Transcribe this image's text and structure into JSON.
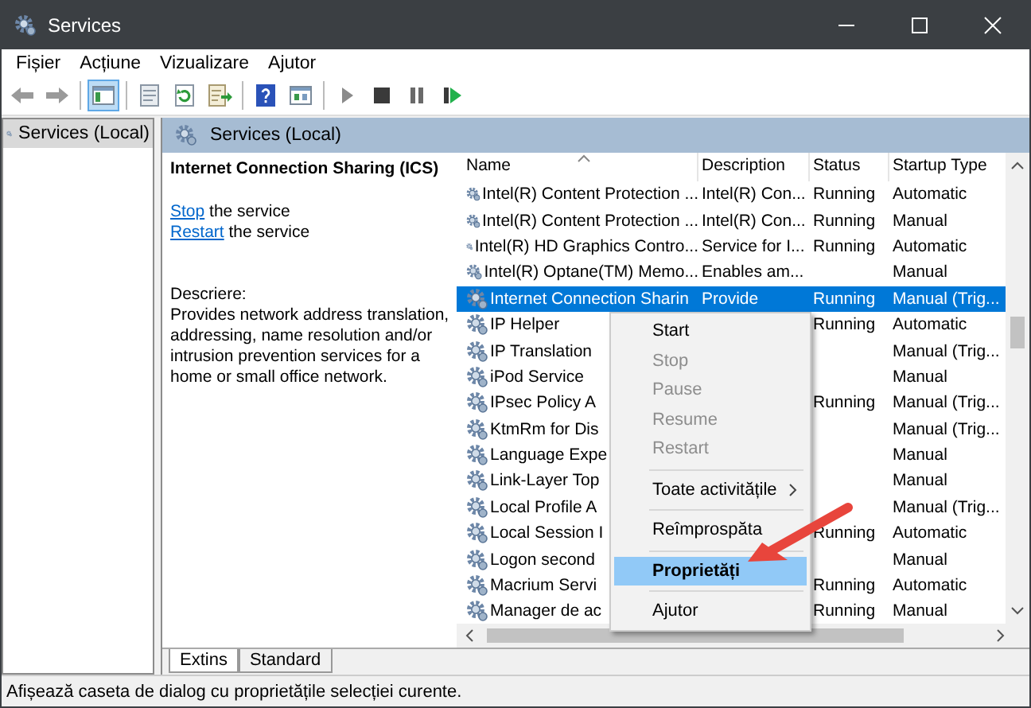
{
  "window": {
    "title": "Services"
  },
  "menu": [
    "Fișier",
    "Acțiune",
    "Vizualizare",
    "Ajutor"
  ],
  "toolbar": [
    {
      "kind": "back",
      "selected": false
    },
    {
      "kind": "forward",
      "selected": false
    },
    {
      "kind": "sep"
    },
    {
      "kind": "tree",
      "selected": true
    },
    {
      "kind": "sep"
    },
    {
      "kind": "props",
      "selected": false
    },
    {
      "kind": "refresh",
      "selected": false
    },
    {
      "kind": "export",
      "selected": false
    },
    {
      "kind": "sep"
    },
    {
      "kind": "help",
      "selected": false
    },
    {
      "kind": "view",
      "selected": false
    },
    {
      "kind": "sep"
    },
    {
      "kind": "play",
      "selected": false
    },
    {
      "kind": "stop",
      "selected": false
    },
    {
      "kind": "pause",
      "selected": false
    },
    {
      "kind": "resume",
      "selected": false
    }
  ],
  "tree": [
    {
      "label": "Services (Local)",
      "selected": true
    }
  ],
  "pane_header": "Services (Local)",
  "details": {
    "title": "Internet Connection Sharing (ICS)",
    "actions": [
      {
        "link": "Stop",
        "text": "the service"
      },
      {
        "link": "Restart",
        "text": "the service"
      }
    ],
    "description_label": "Descriere:",
    "description": "Provides network address translation, addressing, name resolution and/or intrusion prevention services for a home or small office network."
  },
  "table": {
    "columns": [
      "Name",
      "Description",
      "Status",
      "Startup Type"
    ],
    "rows": [
      {
        "name": "Intel(R) Content Protection ...",
        "description": "Intel(R) Con...",
        "status": "Running",
        "startup": "Automatic",
        "selected": false
      },
      {
        "name": "Intel(R) Content Protection ...",
        "description": "Intel(R) Con...",
        "status": "Running",
        "startup": "Manual",
        "selected": false
      },
      {
        "name": "Intel(R) HD Graphics Contro...",
        "description": "Service for I...",
        "status": "Running",
        "startup": "Automatic",
        "selected": false
      },
      {
        "name": "Intel(R) Optane(TM) Memo...",
        "description": "Enables am...",
        "status": "",
        "startup": "Manual",
        "selected": false
      },
      {
        "name": "Internet Connection Sharin",
        "description": "Provide",
        "status": "Running",
        "startup": "Manual (Trig...",
        "selected": true
      },
      {
        "name": "IP Helper",
        "description": "",
        "status": "Running",
        "startup": "Automatic",
        "selected": false
      },
      {
        "name": "IP Translation",
        "description": "",
        "status": "",
        "startup": "Manual (Trig...",
        "selected": false
      },
      {
        "name": "iPod Service",
        "description": "",
        "status": "",
        "startup": "Manual",
        "selected": false
      },
      {
        "name": "IPsec Policy A",
        "description": "",
        "status": "Running",
        "startup": "Manual (Trig...",
        "selected": false
      },
      {
        "name": "KtmRm for Dis",
        "description": "",
        "status": "",
        "startup": "Manual (Trig...",
        "selected": false
      },
      {
        "name": "Language Expe",
        "description": "",
        "status": "",
        "startup": "Manual",
        "selected": false
      },
      {
        "name": "Link-Layer Top",
        "description": "",
        "status": "",
        "startup": "Manual",
        "selected": false
      },
      {
        "name": "Local Profile A",
        "description": "",
        "status": "",
        "startup": "Manual (Trig...",
        "selected": false
      },
      {
        "name": "Local Session I",
        "description": "",
        "status": "Running",
        "startup": "Automatic",
        "selected": false
      },
      {
        "name": "Logon second",
        "description": "",
        "status": "",
        "startup": "Manual",
        "selected": false
      },
      {
        "name": "Macrium Servi",
        "description": "",
        "status": "Running",
        "startup": "Automatic",
        "selected": false
      },
      {
        "name": "Manager de ac",
        "description": "",
        "status": "Running",
        "startup": "Manual",
        "selected": false
      }
    ]
  },
  "context_menu": [
    {
      "kind": "item",
      "label": "Start",
      "disabled": false,
      "selected": false
    },
    {
      "kind": "item",
      "label": "Stop",
      "disabled": true,
      "selected": false
    },
    {
      "kind": "item",
      "label": "Pause",
      "disabled": true,
      "selected": false
    },
    {
      "kind": "item",
      "label": "Resume",
      "disabled": true,
      "selected": false
    },
    {
      "kind": "item",
      "label": "Restart",
      "disabled": true,
      "selected": false
    },
    {
      "kind": "separator"
    },
    {
      "kind": "submenu",
      "label": "Toate activitățile",
      "disabled": false,
      "selected": false
    },
    {
      "kind": "separator"
    },
    {
      "kind": "item",
      "label": "Reîmprospăta",
      "disabled": false,
      "selected": false
    },
    {
      "kind": "separator"
    },
    {
      "kind": "default",
      "label": "Proprietăți",
      "disabled": false,
      "selected": true
    },
    {
      "kind": "separator"
    },
    {
      "kind": "item",
      "label": "Ajutor",
      "disabled": false,
      "selected": false
    }
  ],
  "view_tabs": [
    {
      "label": "Extins",
      "selected": true
    },
    {
      "label": "Standard",
      "selected": false
    }
  ],
  "status_bar": "Afișează caseta de dialog cu proprietățile selecției curente."
}
